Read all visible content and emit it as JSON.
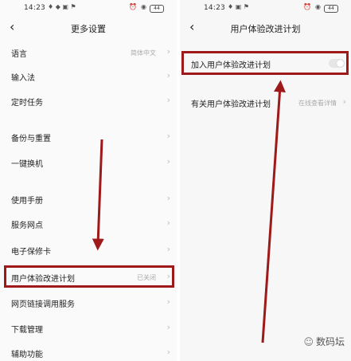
{
  "left": {
    "status": {
      "time": "14:23",
      "battery": "44"
    },
    "header": {
      "title": "更多设置"
    },
    "items": [
      {
        "label": "语言",
        "value": "简体中文"
      },
      {
        "label": "输入法",
        "value": ""
      },
      {
        "label": "定时任务",
        "value": ""
      },
      {
        "label": "备份与重置",
        "value": ""
      },
      {
        "label": "一键换机",
        "value": ""
      },
      {
        "label": "使用手册",
        "value": ""
      },
      {
        "label": "服务网点",
        "value": ""
      },
      {
        "label": "电子保修卡",
        "value": ""
      },
      {
        "label": "用户体验改进计划",
        "value": "已关闭"
      },
      {
        "label": "网页链接调用服务",
        "value": ""
      },
      {
        "label": "下载管理",
        "value": ""
      },
      {
        "label": "辅助功能",
        "value": ""
      }
    ]
  },
  "right": {
    "status": {
      "time": "14:23",
      "battery": "44"
    },
    "header": {
      "title": "用户体验改进计划"
    },
    "join_label": "加入用户体验改进计划",
    "join_enabled": false,
    "about_label": "有关用户体验改进计划",
    "about_link": "在线查看详情"
  },
  "watermark": "数码坛",
  "colors": {
    "highlight": "#9e1a1a",
    "secondary_text": "#aaaaaa"
  }
}
